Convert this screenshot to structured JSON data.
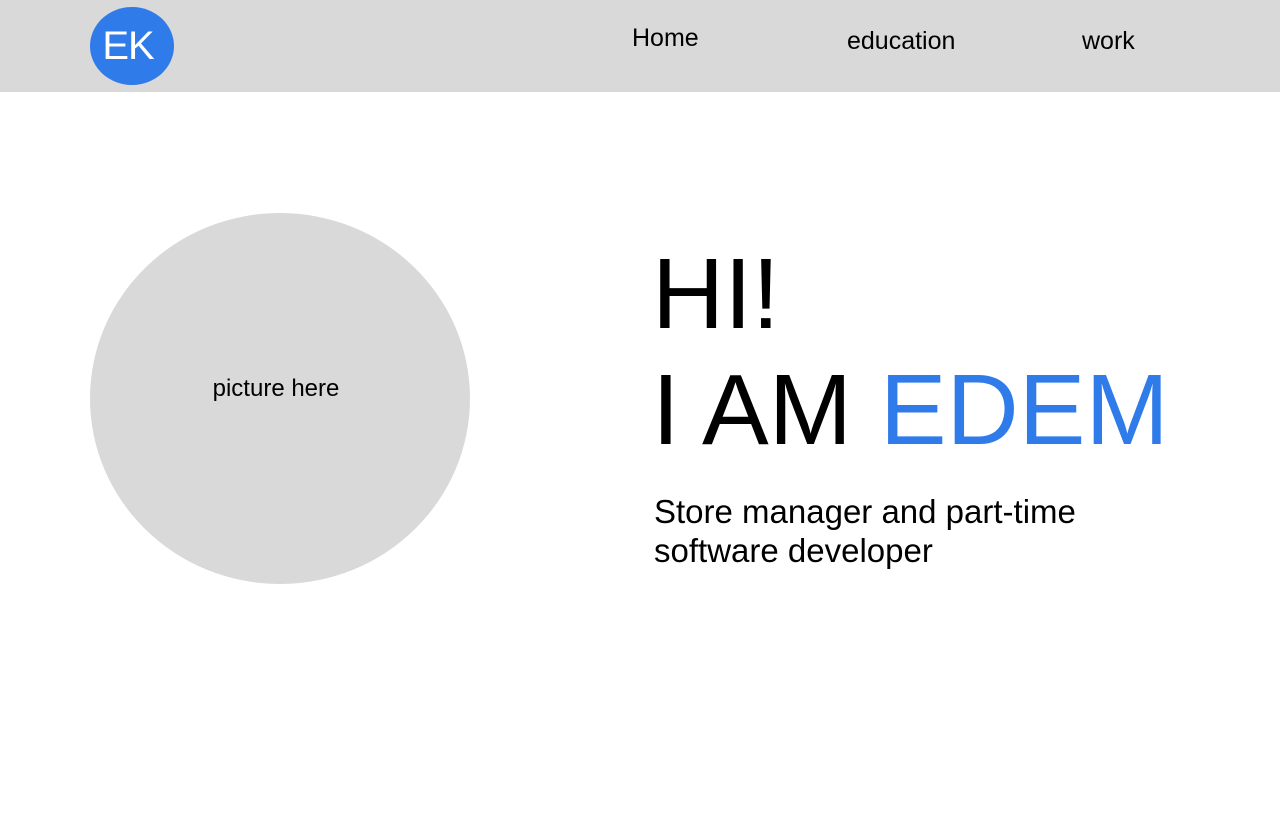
{
  "header": {
    "logo_text": "EK",
    "nav": {
      "home": "Home",
      "education": "education",
      "work": "work"
    }
  },
  "hero": {
    "picture_placeholder": "picture here",
    "greeting": "HI!",
    "intro_prefix": "I AM",
    "name": "EDEM",
    "subtitle": "Store manager and part-time software developer"
  },
  "colors": {
    "accent": "#2f7bea",
    "header_background": "#d9d9d9",
    "placeholder_background": "#d9d9d9"
  }
}
